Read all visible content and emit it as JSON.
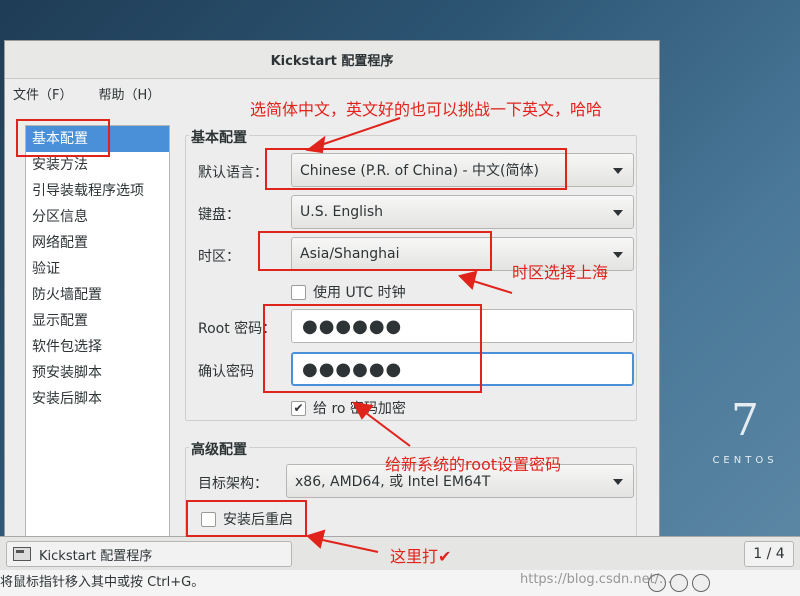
{
  "window": {
    "title": "Kickstart 配置程序"
  },
  "menubar": {
    "items": [
      "文件（F）",
      "帮助（H）"
    ]
  },
  "sidebar": {
    "items": [
      "基本配置",
      "安装方法",
      "引导装载程序选项",
      "分区信息",
      "网络配置",
      "验证",
      "防火墙配置",
      "显示配置",
      "软件包选择",
      "预安装脚本",
      "安装后脚本"
    ],
    "selected_index": 0
  },
  "basic": {
    "section_title": "基本配置",
    "language": {
      "label": "默认语言：",
      "value": "Chinese (P.R. of China) - 中文(简体)"
    },
    "keyboard": {
      "label": "键盘：",
      "value": "U.S. English"
    },
    "timezone": {
      "label": "时区：",
      "value": "Asia/Shanghai"
    },
    "utc": {
      "label": "使用  UTC 时钟",
      "checked": false
    },
    "root_password": {
      "label": "Root 密码：",
      "value": "●●●●●●"
    },
    "confirm_password": {
      "label": "确认密码",
      "value": "●●●●●●"
    },
    "encrypt": {
      "label": "给  ro   密码加密",
      "checked": true
    }
  },
  "advanced": {
    "section_title": "高级配置",
    "arch": {
      "label": "目标架构：",
      "value": "x86, AMD64, 或  Intel EM64T"
    },
    "reboot": {
      "label": "安装后重启",
      "checked": false
    }
  },
  "taskbar": {
    "app_label": "Kickstart 配置程序",
    "page_indicator": "1 / 4"
  },
  "statusbar": {
    "text": "将鼠标指针移入其中或按 Ctrl+G。"
  },
  "desktop": {
    "logo_number": "7",
    "logo_text": "CENTOS"
  },
  "watermark": "https://blog.csdn.net/...",
  "annotations": {
    "language_note": "选简体中文，英文好的也可以挑战一下英文，哈哈",
    "timezone_note": "时区选择上海",
    "password_note": "给新系统的root设置密码",
    "reboot_note": "这里打✔",
    "color": "#e0231b"
  },
  "colors": {
    "selection": "#4a90d9",
    "window_bg": "#ededed"
  }
}
